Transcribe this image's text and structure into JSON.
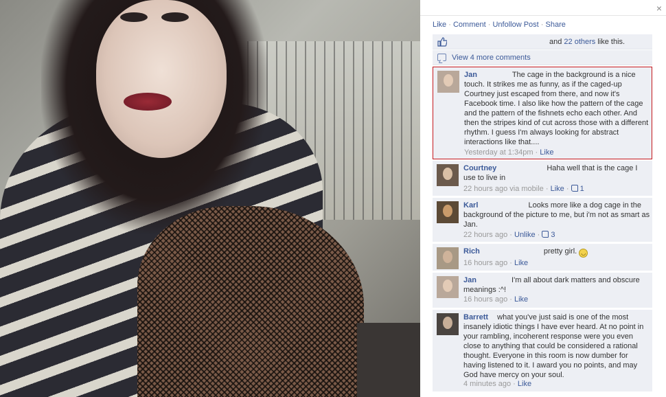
{
  "close": "×",
  "actions": {
    "like": "Like",
    "comment": "Comment",
    "unfollow": "Unfollow Post",
    "share": "Share",
    "sep": "·"
  },
  "likes": {
    "prefix": "and",
    "others": "22 others",
    "suffix": "like this."
  },
  "more_comments": "View 4 more comments",
  "comments": [
    {
      "name": "Jan",
      "text": "The cage in the background is a nice touch. It strikes me as funny, as if the caged-up Courtney just escaped from there, and now it's Facebook time. I also like how the pattern of the cage and the pattern of the fishnets echo each other. And then the stripes kind of cut across those with a different rhythm. I guess I'm always looking for abstract interactions like that....",
      "time": "Yesterday at 1:34pm",
      "action": "Like"
    },
    {
      "name": "Courtney",
      "text": "Haha well that is the cage I use to live in",
      "time": "22 hours ago via mobile",
      "action": "Like",
      "likes": "1"
    },
    {
      "name": "Karl",
      "text": "Looks more like a dog cage in the background of the picture to me, but i'm not as smart as Jan.",
      "time": "22 hours ago",
      "action": "Unlike",
      "likes": "3"
    },
    {
      "name": "Rich",
      "text": "pretty girl.",
      "time": "16 hours ago",
      "action": "Like"
    },
    {
      "name": "Jan",
      "text": "I'm all about dark matters and obscure meanings :^!",
      "time": "16 hours ago",
      "action": "Like"
    },
    {
      "name": "Barrett",
      "text": "what you've just said is one of the most insanely idiotic things I have ever heard. At no point in your rambling, incoherent response were you even close to anything that could be considered a rational thought. Everyone in this room is now dumber for having listened to it. I award you no points, and may God have mercy on your soul.",
      "time": "4 minutes ago",
      "action": "Like"
    }
  ],
  "colors": {
    "link": "#3b5998",
    "panel_bg": "#edeff4",
    "highlight_border": "#c4161c",
    "meta": "#999999"
  }
}
